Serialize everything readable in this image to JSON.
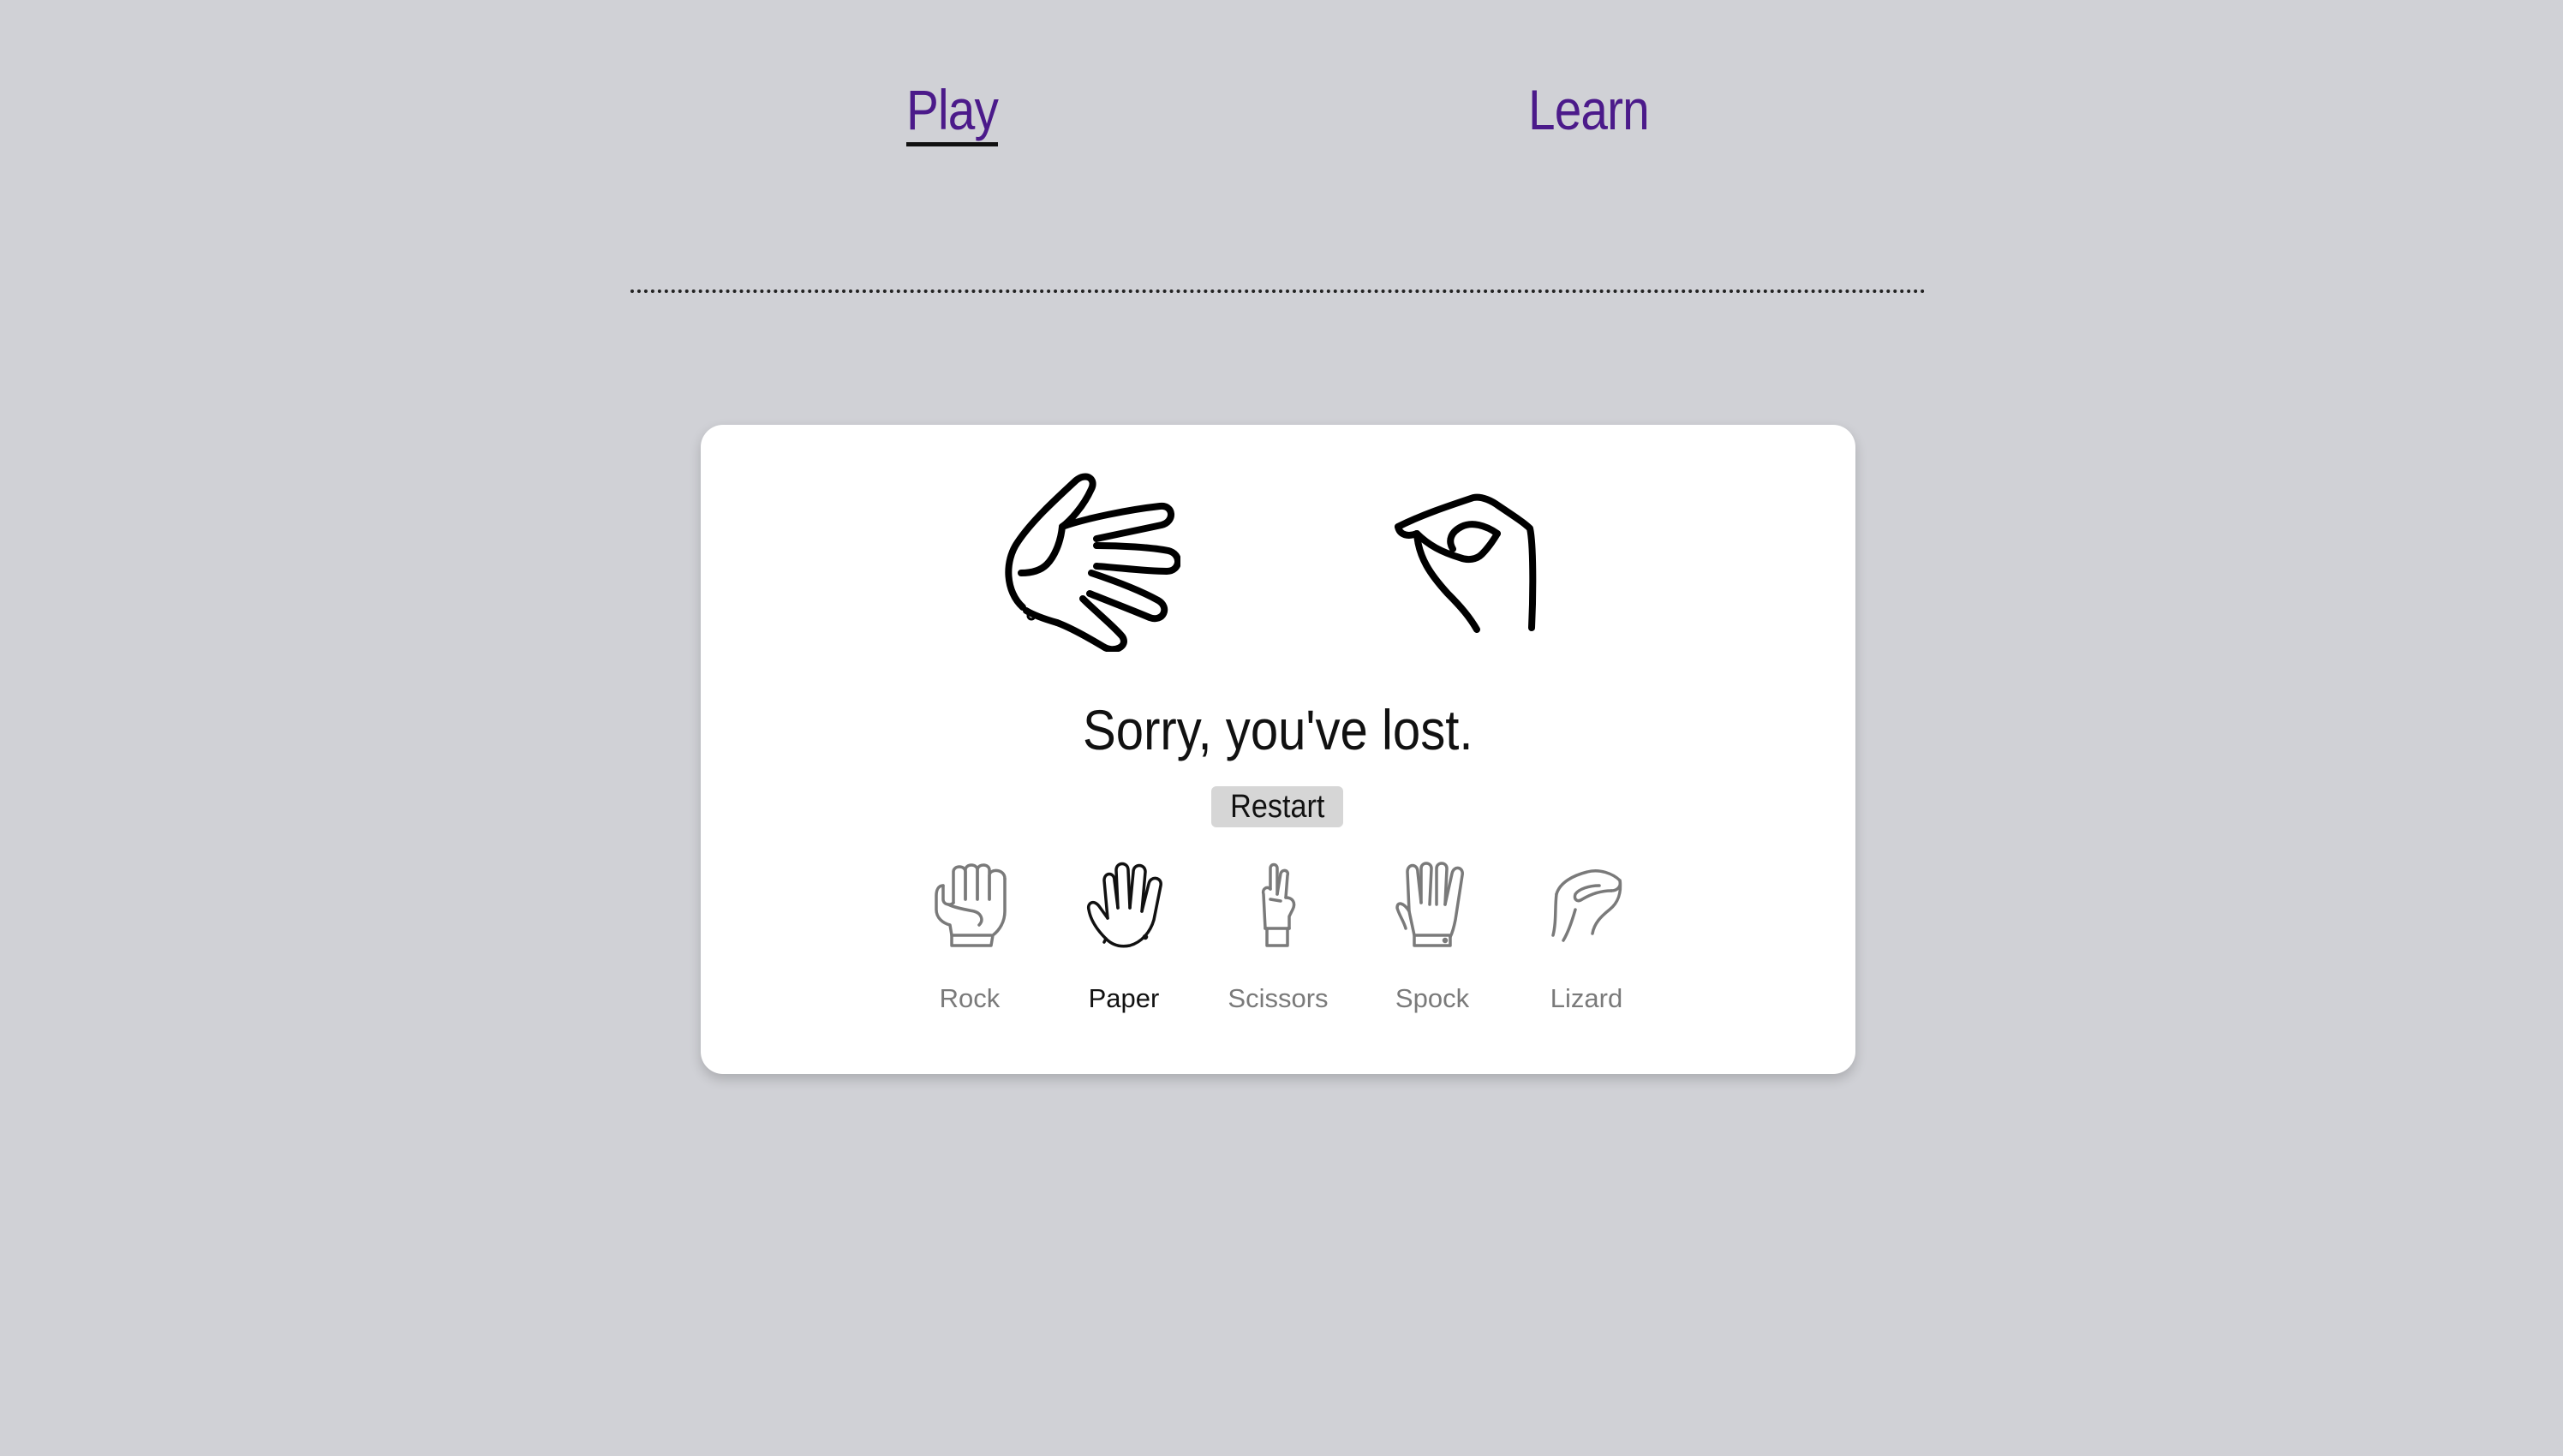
{
  "nav": {
    "play_label": "Play",
    "learn_label": "Learn",
    "active": "Play",
    "link_color": "#4b1a8a"
  },
  "game": {
    "player_hand_icon": "paper-hand-icon",
    "computer_hand_icon": "lizard-hand-icon",
    "result_text": "Sorry, you've lost.",
    "restart_label": "Restart"
  },
  "choices": [
    {
      "label": "Rock",
      "icon": "rock-hand-icon",
      "selected": false
    },
    {
      "label": "Paper",
      "icon": "paper-hand-icon",
      "selected": true
    },
    {
      "label": "Scissors",
      "icon": "scissors-hand-icon",
      "selected": false
    },
    {
      "label": "Spock",
      "icon": "spock-hand-icon",
      "selected": false
    },
    {
      "label": "Lizard",
      "icon": "lizard-hand-icon",
      "selected": false
    }
  ],
  "colors": {
    "background": "#d0d1d6",
    "card": "#ffffff",
    "selected_text": "#111111",
    "unselected_text": "#7a7a7a"
  }
}
